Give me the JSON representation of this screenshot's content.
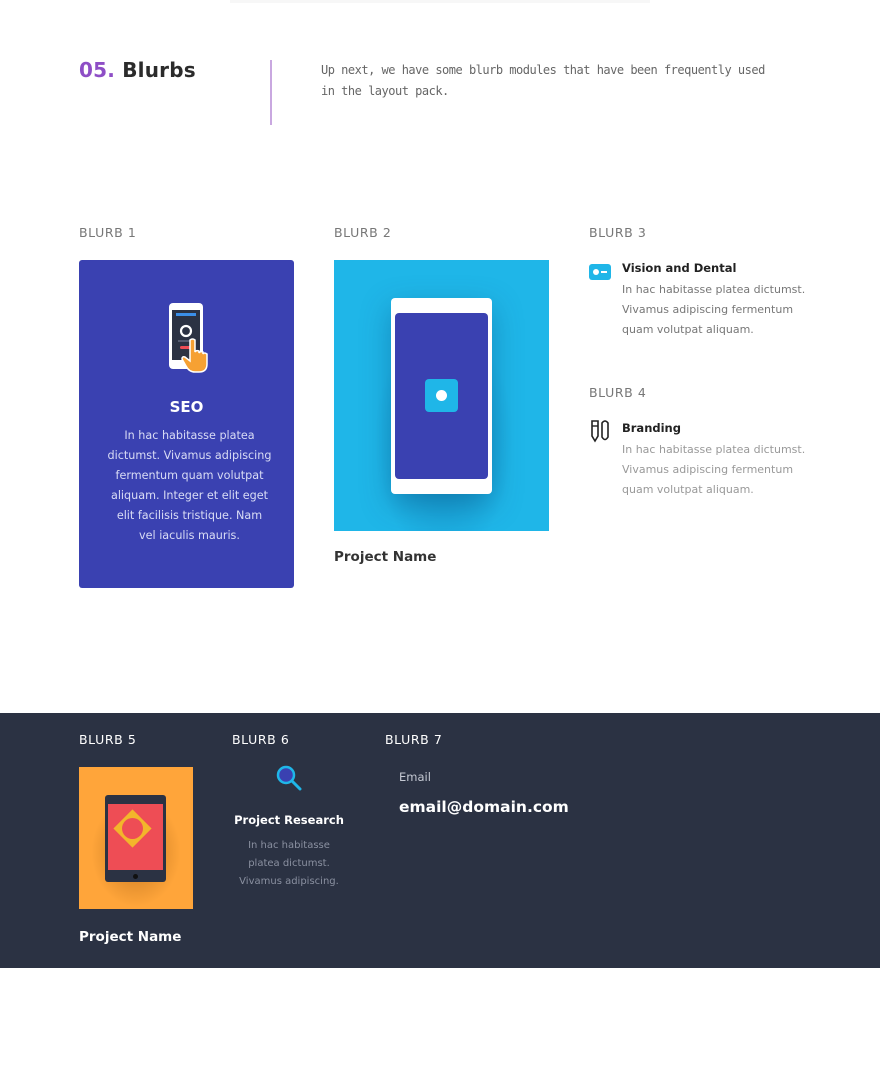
{
  "intro": {
    "number": "05.",
    "title": "Blurbs",
    "description": "Up next, we have some blurb modules that have been frequently used in the layout pack."
  },
  "blurbs": {
    "b1": {
      "label": "BLURB 1",
      "icon": "phone-tap-icon",
      "title": "SEO",
      "body": "In hac habitasse platea dictumst. Vivamus adipiscing fermentum quam volutpat aliquam. Integer et elit eget elit facilisis tristique. Nam vel iaculis mauris."
    },
    "b2": {
      "label": "BLURB 2",
      "image": "phone-illustration",
      "caption": "Project Name"
    },
    "b3": {
      "label": "BLURB 3",
      "icon": "toggle-card-icon",
      "title": "Vision and Dental",
      "body": "In hac habitasse platea dictumst. Vivamus adipiscing fermentum quam volutpat aliquam."
    },
    "b4": {
      "label": "BLURB 4",
      "icon": "pens-icon",
      "title": "Branding",
      "body": "In hac habitasse platea dictumst. Vivamus adipiscing fermentum quam volutpat aliquam."
    },
    "b5": {
      "label": "BLURB 5",
      "image": "tablet-illustration",
      "caption": "Project Name"
    },
    "b6": {
      "label": "BLURB 6",
      "icon": "magnifier-icon",
      "title": "Project Research",
      "body": "In hac habitasse platea dictumst. Vivamus adipiscing."
    },
    "b7": {
      "label": "BLURB 7",
      "field_label": "Email",
      "email": "email@domain.com"
    }
  },
  "colors": {
    "accent_purple": "#8e4ec6",
    "card_blue": "#3a41b1",
    "sky_blue": "#1fb6e8",
    "dark_bg": "#2b3243",
    "orange": "#ffa53a",
    "red": "#ee4d55"
  }
}
